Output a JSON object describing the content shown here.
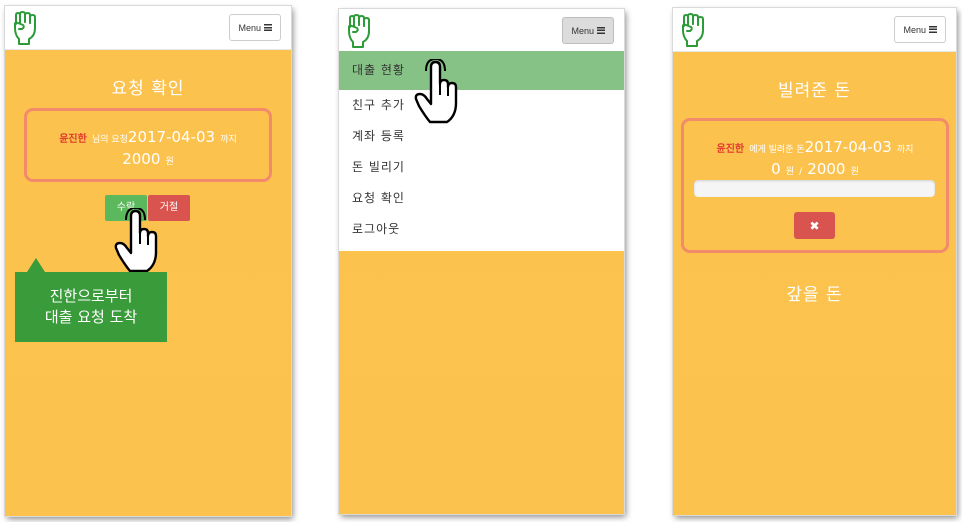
{
  "screens": [
    {
      "menu_label": "Menu",
      "title": "요청 확인",
      "request": {
        "name": "윤진한",
        "suffix": "님의 요청",
        "date": "2017-04-03",
        "until": "까지",
        "amount": "2000",
        "unit": "원"
      },
      "accept_label": "수락",
      "reject_label": "거절",
      "tooltip": [
        "진한으로부터",
        "대출 요청 도착"
      ]
    },
    {
      "menu_label": "Menu",
      "menu_items": [
        "대출 현황",
        "친구 추가",
        "계좌 등록",
        "돈 빌리기",
        "요청 확인",
        "로그아웃"
      ],
      "highlighted_item": "대출 현황"
    },
    {
      "menu_label": "Menu",
      "title": "빌려준 돈",
      "loan": {
        "name": "윤진한",
        "suffix": "에게 빌려준 돈",
        "date": "2017-04-03",
        "until": "까지",
        "paid": "0",
        "unit1": "원",
        "separator": "/",
        "total": "2000",
        "unit2": "원",
        "progress": 0
      },
      "section_title": "갚을 돈"
    }
  ],
  "colors": {
    "background": "#fcc24e",
    "card_border": "#f28a6b",
    "name_red": "#e23a2e",
    "accept": "#5cb85c",
    "reject": "#d9534f",
    "tooltip": "#3a9b3a",
    "menu_highlight": "#86c286"
  },
  "icons": [
    "fist-logo-icon",
    "hamburger-icon",
    "pointing-hand-icon",
    "times-icon"
  ]
}
